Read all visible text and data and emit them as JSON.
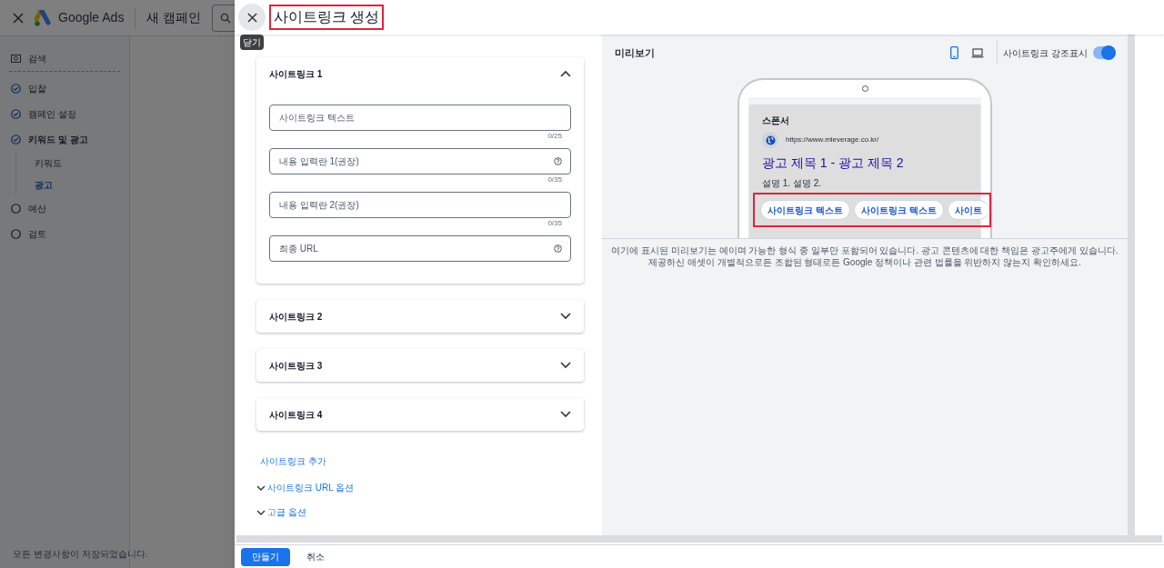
{
  "app": {
    "brand": "Google Ads",
    "campaign": "새 캠페인"
  },
  "sidebar": {
    "items": [
      {
        "label": "검색",
        "kind": "search"
      },
      {
        "label": "입찰",
        "kind": "step",
        "done": true
      },
      {
        "label": "캠페인 설정",
        "kind": "step",
        "done": true
      },
      {
        "label": "키워드 및 광고",
        "kind": "step",
        "done": true,
        "children": [
          {
            "label": "키워드",
            "selected": false
          },
          {
            "label": "광고",
            "selected": true
          }
        ]
      },
      {
        "label": "예산",
        "kind": "step",
        "done": false
      },
      {
        "label": "검토",
        "kind": "step",
        "done": false
      }
    ],
    "status": "모든 변경사항이 저장되었습니다."
  },
  "panel": {
    "title": "사이트링크 생성",
    "close_tooltip": "닫기",
    "sitelinks": [
      {
        "label": "사이트링크 1",
        "expanded": true,
        "fields": [
          {
            "placeholder": "사이트링크 텍스트",
            "counter": "0/25",
            "help": false
          },
          {
            "placeholder": "내용 입력란 1(권장)",
            "counter": "0/35",
            "help": true
          },
          {
            "placeholder": "내용 입력란 2(권장)",
            "counter": "0/35",
            "help": false
          },
          {
            "placeholder": "최종 URL",
            "help": true
          }
        ]
      },
      {
        "label": "사이트링크 2",
        "expanded": false
      },
      {
        "label": "사이트링크 3",
        "expanded": false
      },
      {
        "label": "사이트링크 4",
        "expanded": false
      }
    ],
    "add_link": "사이트링크 추가",
    "options": [
      "사이트링크 URL 옵션",
      "고급 옵션"
    ],
    "buttons": [
      {
        "label": "만들기",
        "kind": "primary"
      },
      {
        "label": "취소",
        "kind": "text"
      }
    ]
  },
  "preview": {
    "title": "미리보기",
    "devices": [
      {
        "kind": "mobile",
        "selected": true
      },
      {
        "kind": "desktop",
        "selected": false
      }
    ],
    "highlight_toggle": {
      "label": "사이트링크 강조표시",
      "on": true
    },
    "ad": {
      "sponsor": "스폰서",
      "url": "https://www.mleverage.co.kr/",
      "headline": "광고 제목 1 - 광고 제목 2",
      "description": "설명 1. 설명 2.",
      "sitelinks": [
        "사이트링크 텍스트",
        "사이트링크 텍스트",
        "사이트"
      ]
    },
    "disclaimer": "여기에 표시된 미리보기는 예이며 가능한 형식 중 일부만 포함되어 있습니다. 광고 콘텐츠에 대한 책임은 광고주에게 있습니다. 제공하신 애셋이 개별적으로든 조합된 형태로든 Google 정책이나 관련 법률을 위반하지 않는지 확인하세요."
  }
}
